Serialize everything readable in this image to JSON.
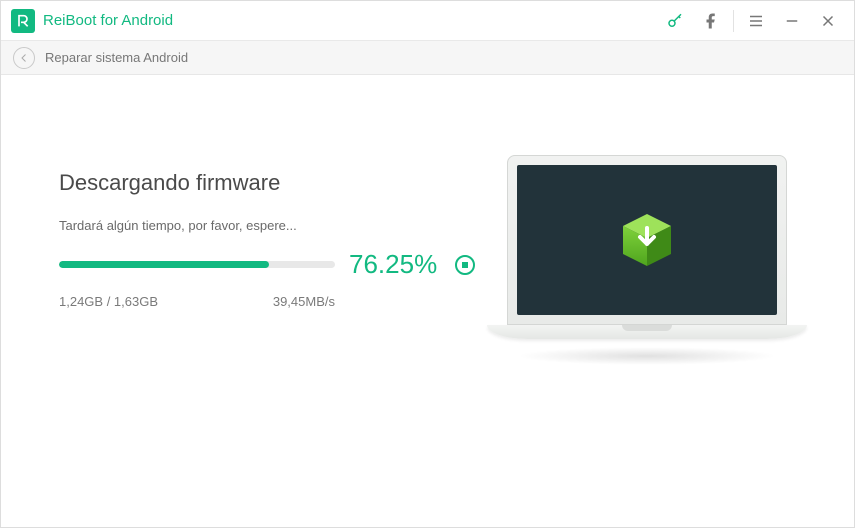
{
  "app": {
    "title": "ReiBoot for Android"
  },
  "breadcrumb": {
    "label": "Reparar sistema Android"
  },
  "download": {
    "heading": "Descargando firmware",
    "subtext": "Tardará algún tiempo, por favor, espere...",
    "percent_label": "76.25%",
    "percent_value": 76.25,
    "size_label": "1,24GB / 1,63GB",
    "speed_label": "39,45MB/s"
  },
  "colors": {
    "accent": "#12b981"
  }
}
